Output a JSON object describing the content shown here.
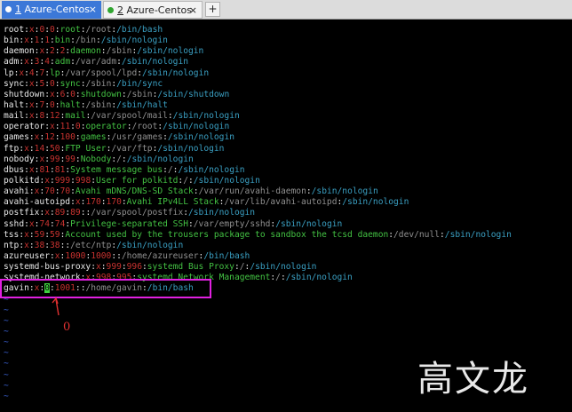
{
  "tabs": [
    {
      "number": "1",
      "title": "Azure-Centos",
      "close": "×",
      "dot_color": "#ffffff",
      "active": true
    },
    {
      "number": "2",
      "title": "Azure-Centos",
      "close": "×",
      "dot_color": "#2fa52f",
      "active": false
    }
  ],
  "new_tab_label": "+",
  "colors": {
    "user": "#e8e8e8",
    "id": "#c8322f",
    "comment": "#43c243",
    "home": "#909090",
    "shell": "#3a9fc2",
    "separator": "#e8e8e8",
    "highlight": "#e020e0",
    "annotation": "#e03030"
  },
  "passwd_lines": [
    {
      "user": "root",
      "pw": "x",
      "uid": "0",
      "gid": "0",
      "comment": "root",
      "home": "/root",
      "shell": "/bin/bash"
    },
    {
      "user": "bin",
      "pw": "x",
      "uid": "1",
      "gid": "1",
      "comment": "bin",
      "home": "/bin",
      "shell": "/sbin/nologin"
    },
    {
      "user": "daemon",
      "pw": "x",
      "uid": "2",
      "gid": "2",
      "comment": "daemon",
      "home": "/sbin",
      "shell": "/sbin/nologin"
    },
    {
      "user": "adm",
      "pw": "x",
      "uid": "3",
      "gid": "4",
      "comment": "adm",
      "home": "/var/adm",
      "shell": "/sbin/nologin"
    },
    {
      "user": "lp",
      "pw": "x",
      "uid": "4",
      "gid": "7",
      "comment": "lp",
      "home": "/var/spool/lpd",
      "shell": "/sbin/nologin"
    },
    {
      "user": "sync",
      "pw": "x",
      "uid": "5",
      "gid": "0",
      "comment": "sync",
      "home": "/sbin",
      "shell": "/bin/sync"
    },
    {
      "user": "shutdown",
      "pw": "x",
      "uid": "6",
      "gid": "0",
      "comment": "shutdown",
      "home": "/sbin",
      "shell": "/sbin/shutdown"
    },
    {
      "user": "halt",
      "pw": "x",
      "uid": "7",
      "gid": "0",
      "comment": "halt",
      "home": "/sbin",
      "shell": "/sbin/halt"
    },
    {
      "user": "mail",
      "pw": "x",
      "uid": "8",
      "gid": "12",
      "comment": "mail",
      "home": "/var/spool/mail",
      "shell": "/sbin/nologin"
    },
    {
      "user": "operator",
      "pw": "x",
      "uid": "11",
      "gid": "0",
      "comment": "operator",
      "home": "/root",
      "shell": "/sbin/nologin"
    },
    {
      "user": "games",
      "pw": "x",
      "uid": "12",
      "gid": "100",
      "comment": "games",
      "home": "/usr/games",
      "shell": "/sbin/nologin"
    },
    {
      "user": "ftp",
      "pw": "x",
      "uid": "14",
      "gid": "50",
      "comment": "FTP User",
      "home": "/var/ftp",
      "shell": "/sbin/nologin"
    },
    {
      "user": "nobody",
      "pw": "x",
      "uid": "99",
      "gid": "99",
      "comment": "Nobody",
      "home": "/",
      "shell": "/sbin/nologin"
    },
    {
      "user": "dbus",
      "pw": "x",
      "uid": "81",
      "gid": "81",
      "comment": "System message bus",
      "home": "/",
      "shell": "/sbin/nologin"
    },
    {
      "user": "polkitd",
      "pw": "x",
      "uid": "999",
      "gid": "998",
      "comment": "User for polkitd",
      "home": "/",
      "shell": "/sbin/nologin"
    },
    {
      "user": "avahi",
      "pw": "x",
      "uid": "70",
      "gid": "70",
      "comment": "Avahi mDNS/DNS-SD Stack",
      "home": "/var/run/avahi-daemon",
      "shell": "/sbin/nologin"
    },
    {
      "user": "avahi-autoipd",
      "pw": "x",
      "uid": "170",
      "gid": "170",
      "comment": "Avahi IPv4LL Stack",
      "home": "/var/lib/avahi-autoipd",
      "shell": "/sbin/nologin"
    },
    {
      "user": "postfix",
      "pw": "x",
      "uid": "89",
      "gid": "89",
      "comment": "",
      "home": "/var/spool/postfix",
      "shell": "/sbin/nologin"
    },
    {
      "user": "sshd",
      "pw": "x",
      "uid": "74",
      "gid": "74",
      "comment": "Privilege-separated SSH",
      "home": "/var/empty/sshd",
      "shell": "/sbin/nologin"
    },
    {
      "user": "tss",
      "pw": "x",
      "uid": "59",
      "gid": "59",
      "comment": "Account used by the trousers package to sandbox the tcsd daemon",
      "home": "/dev/null",
      "shell": "/sbin/nologin"
    },
    {
      "user": "ntp",
      "pw": "x",
      "uid": "38",
      "gid": "38",
      "comment": "",
      "home": "/etc/ntp",
      "shell": "/sbin/nologin"
    },
    {
      "user": "azureuser",
      "pw": "x",
      "uid": "1000",
      "gid": "1000",
      "comment": "",
      "home": "/home/azureuser",
      "shell": "/bin/bash"
    },
    {
      "user": "systemd-bus-proxy",
      "pw": "x",
      "uid": "999",
      "gid": "996",
      "comment": "systemd Bus Proxy",
      "home": "/",
      "shell": "/sbin/nologin"
    },
    {
      "user": "systemd-network",
      "pw": "x",
      "uid": "998",
      "gid": "995",
      "comment": "systemd Network Management",
      "home": "/",
      "shell": "/sbin/nologin"
    },
    {
      "user": "gavin",
      "pw": "x",
      "uid": "0",
      "gid": "1001",
      "comment": "",
      "home": "/home/gavin",
      "shell": "/bin/bash"
    }
  ],
  "tilde": "~",
  "tilde_count": 10,
  "annotation_label": "0",
  "watermark": "高文龙"
}
